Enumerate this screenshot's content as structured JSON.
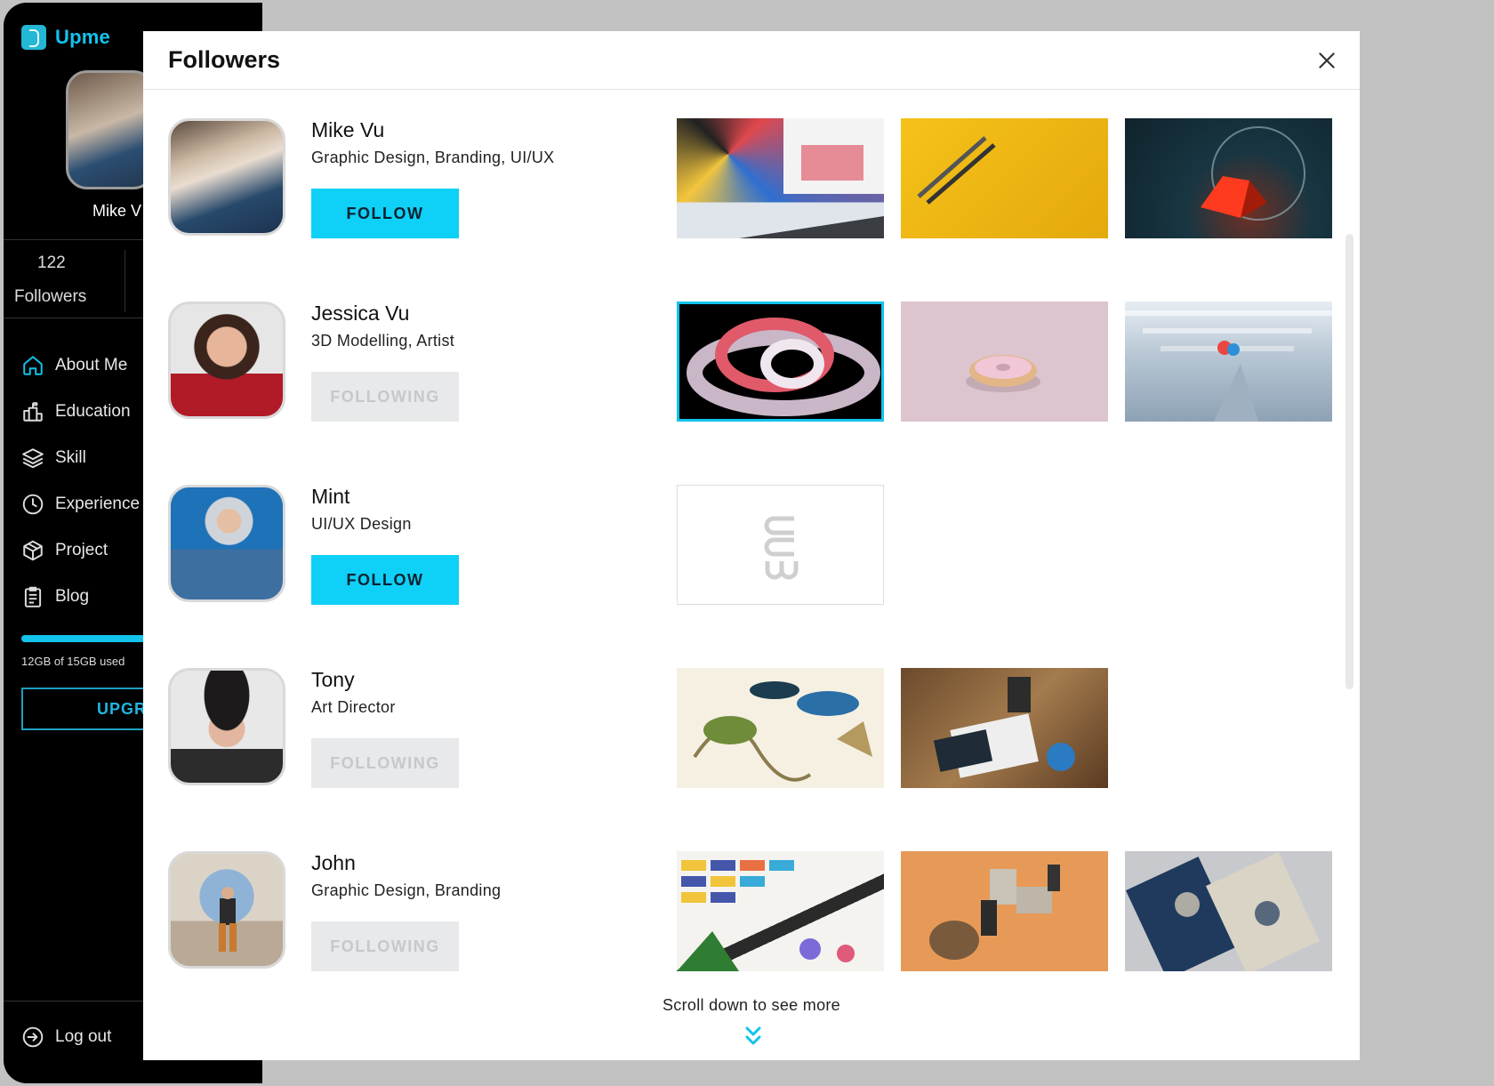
{
  "app": {
    "brand_name": "Upme",
    "accent": "#12c3ec"
  },
  "sidebar": {
    "user_name": "Mike V",
    "followers_count": "122",
    "followers_label": "Followers",
    "nav": [
      {
        "label": "About Me",
        "icon": "home-icon"
      },
      {
        "label": "Education",
        "icon": "education-icon"
      },
      {
        "label": "Skill",
        "icon": "layers-icon"
      },
      {
        "label": "Experience",
        "icon": "clock-icon"
      },
      {
        "label": "Project",
        "icon": "cube-icon"
      },
      {
        "label": "Blog",
        "icon": "clipboard-icon"
      }
    ],
    "storage_text": "12GB of 15GB used",
    "storage_fraction": 0.8,
    "upgrade_label": "UPGRA",
    "logout_label": "Log out"
  },
  "modal": {
    "title": "Followers",
    "scroll_hint": "Scroll down to see more",
    "followers": [
      {
        "name": "Mike Vu",
        "skills": "Graphic Design, Branding, UI/UX",
        "button": "FOLLOW",
        "state": "follow"
      },
      {
        "name": "Jessica Vu",
        "skills": "3D Modelling, Artist",
        "button": "FOLLOWING",
        "state": "following"
      },
      {
        "name": "Mint",
        "skills": "UI/UX Design",
        "button": "FOLLOW",
        "state": "follow"
      },
      {
        "name": "Tony",
        "skills": "Art Director",
        "button": "FOLLOWING",
        "state": "following"
      },
      {
        "name": "John",
        "skills": "Graphic Design, Branding",
        "button": "FOLLOWING",
        "state": "following"
      }
    ]
  }
}
